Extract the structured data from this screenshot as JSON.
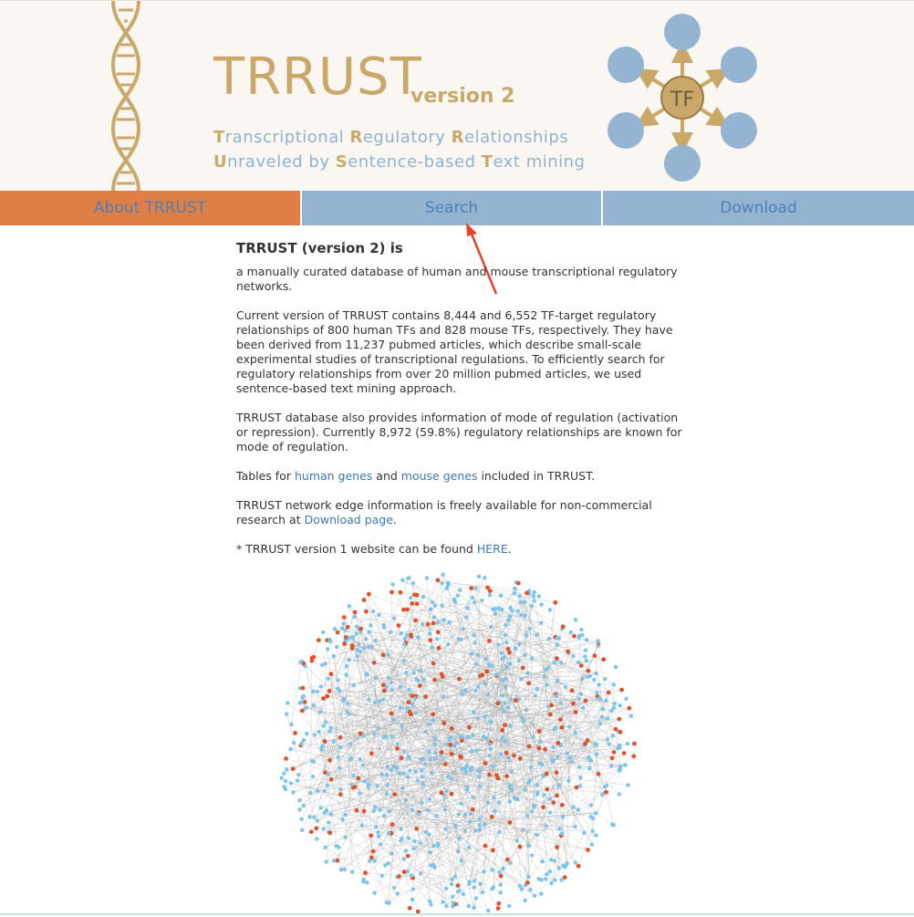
{
  "header": {
    "title": "TRRUST",
    "version": "version 2",
    "tagline_1": {
      "initial_1": "T",
      "rest_1": "ranscriptional ",
      "initial_2": "R",
      "rest_2": "egulatory ",
      "initial_3": "R",
      "rest_3": "elationships"
    },
    "tagline_2": {
      "initial_1": "U",
      "rest_1": "nraveled by ",
      "initial_2": "S",
      "rest_2": "entence-based ",
      "initial_3": "T",
      "rest_3": "ext mining"
    },
    "logo_center_label": "TF"
  },
  "nav": {
    "about": "About TRRUST",
    "search": "Search",
    "download": "Download"
  },
  "content": {
    "heading": "TRRUST (version 2) is",
    "intro": "a manually curated database of human and mouse transcriptional regulatory networks.",
    "current_version": "Current version of TRRUST contains 8,444 and 6,552 TF-target regulatory relationships of 800 human TFs and 828 mouse TFs, respectively. They have been derived from 11,237 pubmed articles, which describe small-scale experimental studies of transcriptional regulations. To efficiently search for regulatory relationships from over 20 million pubmed articles, we used sentence-based text mining approach.",
    "mode_of_regulation": "TRRUST database also provides information of mode of regulation (activation or repression). Currently 8,972 (59.8%) regulatory relationships are known for mode of regulation.",
    "tables_prefix": "Tables for ",
    "human_genes_link": "human genes",
    "tables_middle": " and ",
    "mouse_genes_link": "mouse genes",
    "tables_suffix": " included in TRRUST.",
    "network_prefix": "TRRUST network edge information is freely available for non-commercial research at ",
    "download_page_link": "Download page",
    "network_suffix": ".",
    "v1_prefix": "* TRRUST version 1 website can be found ",
    "here_link": "HERE",
    "v1_suffix": "."
  },
  "colors": {
    "gold": "#c9a86a",
    "light_blue": "#8fb2d2",
    "nav_blue": "#94b4d2",
    "nav_active": "#e07f45",
    "link": "#3a77b7",
    "node_blue": "#7dc3ea",
    "node_red": "#e0532a"
  }
}
